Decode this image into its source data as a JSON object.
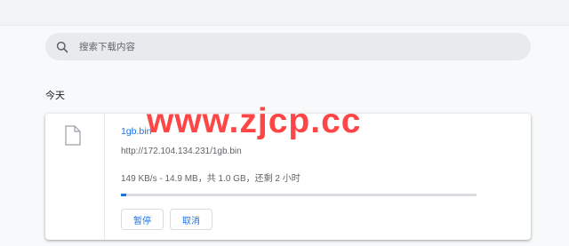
{
  "search": {
    "placeholder": "搜索下载内容",
    "icon": "search-icon"
  },
  "section": {
    "title": "今天"
  },
  "download": {
    "file_name": "1gb.bin",
    "url": "http://172.104.134.231/1gb.bin",
    "status": "149 KB/s - 14.9 MB，共 1.0 GB，还剩 2 小时",
    "progress": 0.0149,
    "pause_label": "暂停",
    "cancel_label": "取消",
    "file_icon": "file-icon"
  },
  "watermark": {
    "text": "www.zjcp.cc"
  },
  "colors": {
    "accent": "#1a73e8",
    "watermark": "#ff4545"
  }
}
